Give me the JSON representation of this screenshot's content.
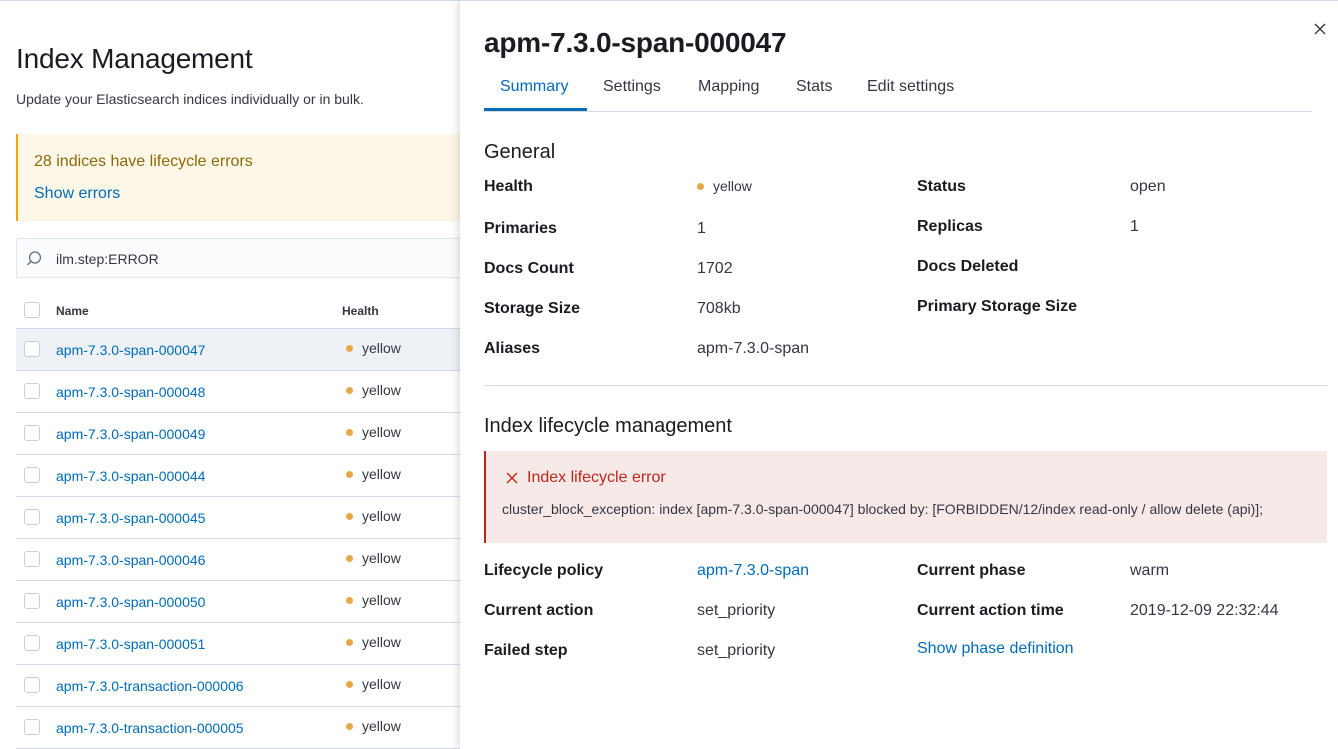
{
  "page": {
    "title": "Index Management",
    "subtitle": "Update your Elasticsearch indices individually or in bulk."
  },
  "callout": {
    "title": "28 indices have lifecycle errors",
    "link": "Show errors"
  },
  "search": {
    "value": "ilm.step:ERROR",
    "icon": "search-icon"
  },
  "table": {
    "columns": {
      "name": "Name",
      "health": "Health"
    },
    "rows": [
      {
        "name": "apm-7.3.0-span-000047",
        "health": "yellow"
      },
      {
        "name": "apm-7.3.0-span-000048",
        "health": "yellow"
      },
      {
        "name": "apm-7.3.0-span-000049",
        "health": "yellow"
      },
      {
        "name": "apm-7.3.0-span-000044",
        "health": "yellow"
      },
      {
        "name": "apm-7.3.0-span-000045",
        "health": "yellow"
      },
      {
        "name": "apm-7.3.0-span-000046",
        "health": "yellow"
      },
      {
        "name": "apm-7.3.0-span-000050",
        "health": "yellow"
      },
      {
        "name": "apm-7.3.0-span-000051",
        "health": "yellow"
      },
      {
        "name": "apm-7.3.0-transaction-000006",
        "health": "yellow"
      },
      {
        "name": "apm-7.3.0-transaction-000005",
        "health": "yellow"
      }
    ]
  },
  "flyout": {
    "title": "apm-7.3.0-span-000047",
    "tabs": [
      "Summary",
      "Settings",
      "Mapping",
      "Stats",
      "Edit settings"
    ],
    "active_tab": "Summary",
    "general": {
      "title": "General",
      "health_label": "Health",
      "health_value": "yellow",
      "status_label": "Status",
      "status_value": "open",
      "primaries_label": "Primaries",
      "primaries_value": "1",
      "replicas_label": "Replicas",
      "replicas_value": "1",
      "docs_count_label": "Docs Count",
      "docs_count_value": "1702",
      "docs_deleted_label": "Docs Deleted",
      "storage_size_label": "Storage Size",
      "storage_size_value": "708kb",
      "primary_storage_label": "Primary Storage Size",
      "aliases_label": "Aliases",
      "aliases_value": "apm-7.3.0-span"
    },
    "ilm": {
      "title": "Index lifecycle management",
      "error_title": "Index lifecycle error",
      "error_text": "cluster_block_exception: index [apm-7.3.0-span-000047] blocked by: [FORBIDDEN/12/index read-only / allow delete (api)];",
      "policy_label": "Lifecycle policy",
      "policy_value": "apm-7.3.0-span",
      "phase_label": "Current phase",
      "phase_value": "warm",
      "action_label": "Current action",
      "action_value": "set_priority",
      "action_time_label": "Current action time",
      "action_time_value": "2019-12-09 22:32:44",
      "failed_step_label": "Failed step",
      "failed_step_value": "set_priority",
      "show_phase_link": "Show phase definition"
    }
  },
  "colors": {
    "link": "#006bb8",
    "health_yellow": "#e7a84a",
    "warning_bg": "#fef6e6",
    "danger": "#bd271e",
    "danger_bg": "#f8e9e9"
  }
}
